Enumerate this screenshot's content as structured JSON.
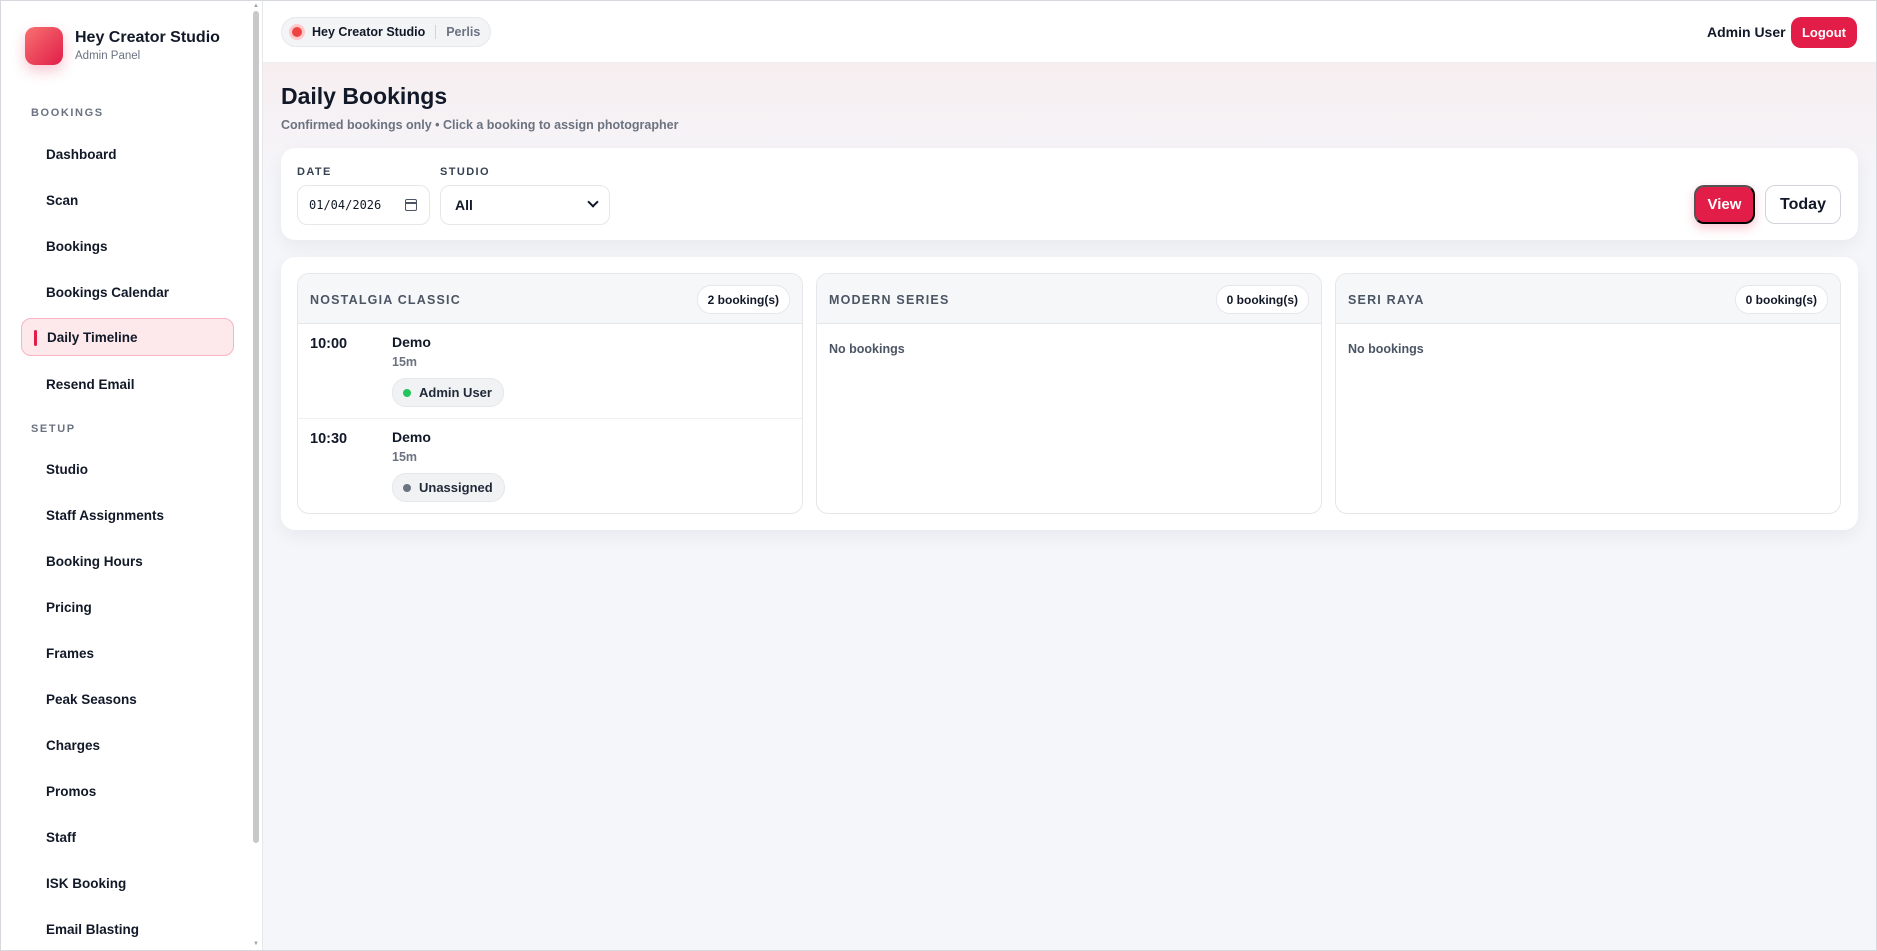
{
  "brand": {
    "title": "Hey Creator Studio",
    "subtitle": "Admin Panel"
  },
  "sidebar": {
    "sections": [
      {
        "label": "BOOKINGS",
        "items": [
          "Dashboard",
          "Scan",
          "Bookings",
          "Bookings Calendar",
          "Daily Timeline",
          "Resend Email"
        ]
      },
      {
        "label": "SETUP",
        "items": [
          "Studio",
          "Staff Assignments",
          "Booking Hours",
          "Pricing",
          "Frames",
          "Peak Seasons",
          "Charges",
          "Promos",
          "Staff",
          "ISK Booking",
          "Email Blasting"
        ]
      }
    ],
    "active_item": "Daily Timeline"
  },
  "topbar": {
    "studio_name": "Hey Creator Studio",
    "location": "Perlis",
    "user_name": "Admin User",
    "logout_label": "Logout"
  },
  "page": {
    "title": "Daily Bookings",
    "subtitle": "Confirmed bookings only • Click a booking to assign photographer"
  },
  "filters": {
    "date_label": "DATE",
    "date_value": "01/04/2026",
    "studio_label": "STUDIO",
    "studio_value": "All",
    "view_label": "View",
    "today_label": "Today"
  },
  "columns": [
    {
      "title": "NOSTALGIA CLASSIC",
      "count": "2 booking(s)",
      "bookings": [
        {
          "time": "10:00",
          "name": "Demo",
          "duration": "15m",
          "assignee": "Admin User",
          "status_color": "#22c55e"
        },
        {
          "time": "10:30",
          "name": "Demo",
          "duration": "15m",
          "assignee": "Unassigned",
          "status_color": "#6b7280"
        }
      ],
      "empty_text": ""
    },
    {
      "title": "MODERN SERIES",
      "count": "0 booking(s)",
      "bookings": [],
      "empty_text": "No bookings"
    },
    {
      "title": "SERI RAYA",
      "count": "0 booking(s)",
      "bookings": [],
      "empty_text": "No bookings"
    }
  ],
  "colors": {
    "accent": "#e11d48",
    "active_bg": "#fde8ec",
    "assigned": "#22c55e",
    "unassigned": "#6b7280"
  },
  "icons": {
    "date_picker": "calendar-icon",
    "select": "chevron-down-icon",
    "studio_status": "status-dot-icon"
  }
}
